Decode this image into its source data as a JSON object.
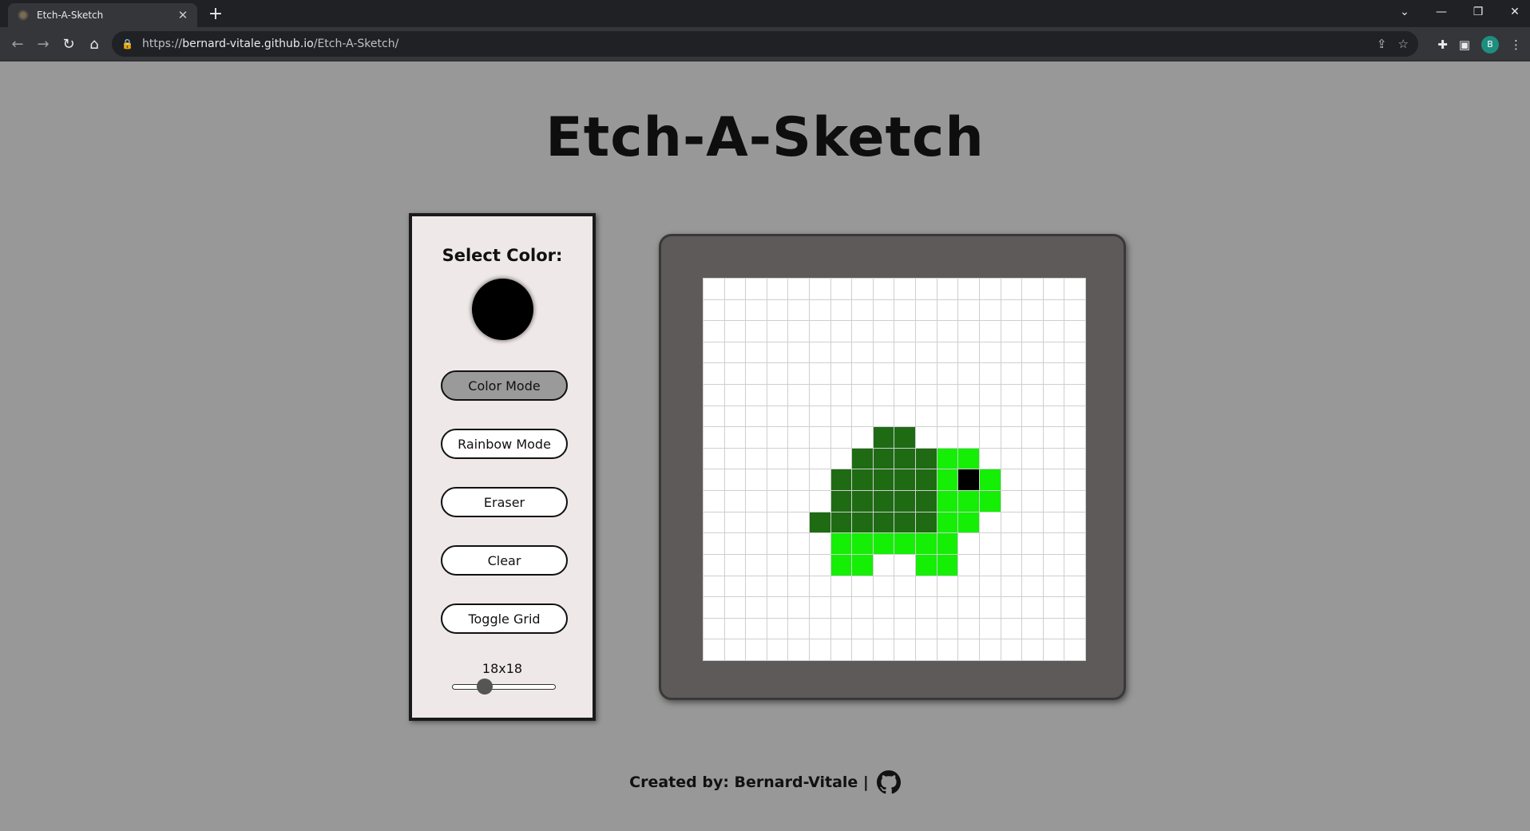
{
  "browser": {
    "tab_title": "Etch-A-Sketch",
    "tab_close": "✕",
    "new_tab": "+",
    "url_scheme": "https://",
    "url_host": "bernard-vitale.github.io",
    "url_path": "/Etch-A-Sketch/",
    "profile_initial": "B"
  },
  "page": {
    "title": "Etch-A-Sketch"
  },
  "panel": {
    "select_label": "Select Color:",
    "selected_color": "#000000",
    "buttons": {
      "color_mode": "Color Mode",
      "rainbow_mode": "Rainbow Mode",
      "eraser": "Eraser",
      "clear": "Clear",
      "toggle_grid": "Toggle Grid"
    },
    "active_mode": "color_mode",
    "grid_size_label": "18x18",
    "slider": {
      "min": 1,
      "max": 64,
      "value": 18
    }
  },
  "canvas": {
    "size": 18,
    "show_grid": true,
    "colors": {
      "D": "#1e6b14",
      "L": "#15ee05",
      "K": "#000000"
    },
    "rows": [
      "..................",
      "..................",
      "..................",
      "..................",
      "..................",
      "..................",
      "..................",
      "........DD........",
      ".......DDDDLL.....",
      "......DDDDDLKL....",
      "......DDDDDLLL....",
      ".....DDDDDDLL.....",
      "......LLLLLL......",
      "......LL..LL......",
      "..................",
      "..................",
      "..................",
      ".................."
    ]
  },
  "footer": {
    "text": "Created by: Bernard-Vitale |"
  },
  "colors": {
    "page_background": "#989898",
    "panel_background": "#efe8e8",
    "board_frame": "#5e5a59",
    "active_button": "#9a9a9a"
  }
}
